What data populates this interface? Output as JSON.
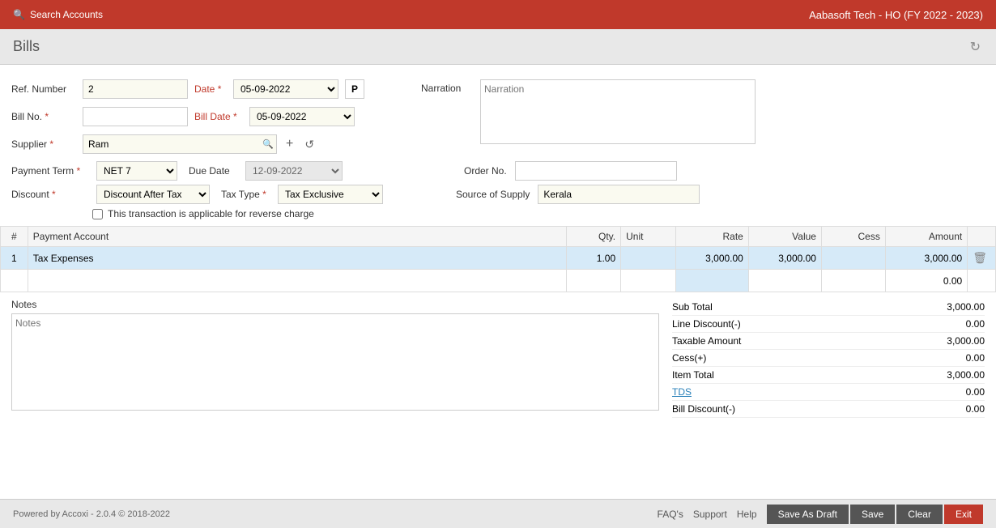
{
  "topbar": {
    "search_placeholder": "Search Accounts",
    "company": "Aabasoft Tech - HO (FY 2022 - 2023)"
  },
  "page": {
    "title": "Bills",
    "refresh_icon": "↻"
  },
  "form": {
    "ref_number_label": "Ref. Number",
    "ref_number_value": "2",
    "date_label": "Date",
    "date_required": "*",
    "date_value": "05-09-2022",
    "bill_no_label": "Bill No.",
    "bill_no_required": "*",
    "bill_date_label": "Bill Date",
    "bill_date_required": "*",
    "bill_date_value": "05-09-2022",
    "supplier_label": "Supplier",
    "supplier_required": "*",
    "supplier_value": "Ram",
    "narration_label": "Narration",
    "narration_placeholder": "Narration",
    "payment_term_label": "Payment Term",
    "payment_term_required": "*",
    "payment_term_value": "NET 7",
    "due_date_label": "Due Date",
    "due_date_value": "12-09-2022",
    "order_no_label": "Order No.",
    "order_no_value": "",
    "discount_label": "Discount",
    "discount_required": "*",
    "discount_value": "Discount After Tax",
    "tax_type_label": "Tax Type",
    "tax_type_required": "*",
    "tax_type_value": "Tax Exclusive",
    "source_of_supply_label": "Source of Supply",
    "source_of_supply_value": "Kerala",
    "reverse_charge_label": "This transaction is applicable for reverse charge"
  },
  "table": {
    "headers": [
      "#",
      "Payment Account",
      "Qty.",
      "Unit",
      "Rate",
      "Value",
      "Cess",
      "Amount"
    ],
    "rows": [
      {
        "num": "1",
        "account": "Tax Expenses",
        "qty": "1.00",
        "unit": "",
        "rate": "3,000.00",
        "value": "3,000.00",
        "cess": "",
        "amount": "3,000.00"
      }
    ],
    "empty_row_amount": "0.00"
  },
  "notes": {
    "label": "Notes",
    "placeholder": "Notes"
  },
  "totals": {
    "sub_total_label": "Sub Total",
    "sub_total_value": "3,000.00",
    "line_discount_label": "Line Discount(-)",
    "line_discount_value": "0.00",
    "taxable_amount_label": "Taxable Amount",
    "taxable_amount_value": "3,000.00",
    "cess_label": "Cess(+)",
    "cess_value": "0.00",
    "item_total_label": "Item Total",
    "item_total_value": "3,000.00",
    "tds_label": "TDS",
    "tds_value": "0.00",
    "bill_discount_label": "Bill Discount(-)",
    "bill_discount_value": "0.00"
  },
  "footer": {
    "powered_by": "Powered by Accoxi - 2.0.4 © 2018-2022",
    "faq": "FAQ's",
    "support": "Support",
    "help": "Help",
    "save_as_draft": "Save As Draft",
    "save": "Save",
    "clear": "Clear",
    "exit": "Exit"
  }
}
